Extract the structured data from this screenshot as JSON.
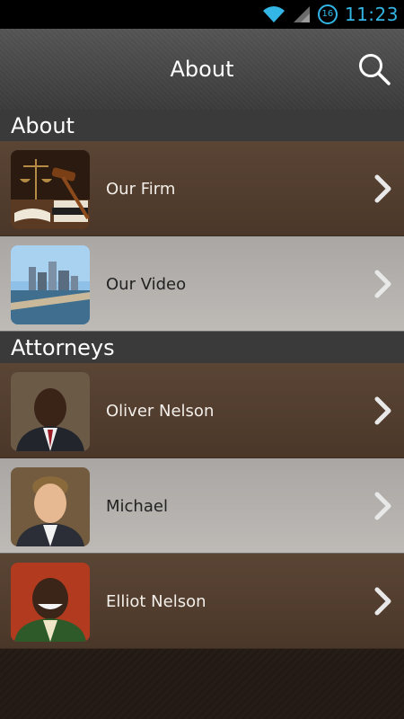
{
  "status_bar": {
    "time": "11:23",
    "notification_count": "16"
  },
  "action_bar": {
    "title": "About"
  },
  "sections": [
    {
      "header": "About",
      "items": [
        {
          "label": "Our Firm"
        },
        {
          "label": "Our Video"
        }
      ]
    },
    {
      "header": "Attorneys",
      "items": [
        {
          "label": "Oliver Nelson"
        },
        {
          "label": "Michael"
        },
        {
          "label": "Elliot Nelson"
        }
      ]
    }
  ],
  "colors": {
    "status_accent": "#33b5e5",
    "dark_row": "#4f3b2d",
    "light_row": "#b3b0ad"
  },
  "icons": {
    "wifi": "wifi-icon",
    "signal": "signal-icon",
    "search": "search-icon",
    "chevron": "chevron-right-icon"
  }
}
